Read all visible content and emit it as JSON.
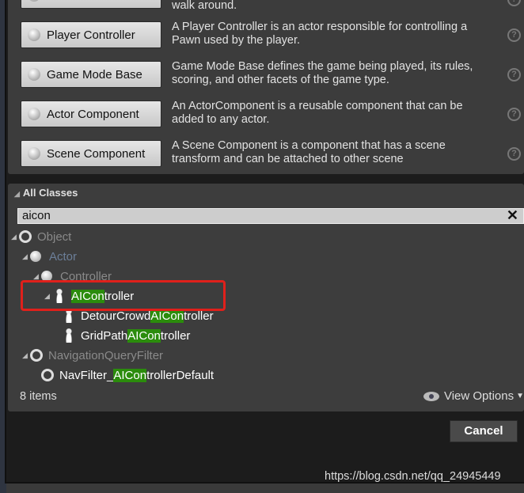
{
  "common_classes": [
    {
      "label": "",
      "desc": "walk around.",
      "icon": "pawn-icon"
    },
    {
      "label": "Player Controller",
      "desc": "A Player Controller is an actor responsible for controlling a Pawn used by the player.",
      "icon": "player-controller-icon"
    },
    {
      "label": "Game Mode Base",
      "desc": "Game Mode Base defines the game being played, its rules, scoring, and other facets of the game type.",
      "icon": "game-mode-icon"
    },
    {
      "label": "Actor Component",
      "desc": "An ActorComponent is a reusable component that can be added to any actor.",
      "icon": "actor-component-icon"
    },
    {
      "label": "Scene Component",
      "desc": "A Scene Component is a component that has a scene transform and can be attached to other scene",
      "icon": "scene-component-icon"
    }
  ],
  "help_glyph": "?",
  "all_classes": {
    "header": "All Classes",
    "search_value": "aicon",
    "clear_glyph": "✕",
    "highlight_color": "#2b8c0c",
    "tree": [
      {
        "pre": "Object",
        "match": "",
        "post": "",
        "color": "#8a8a8a",
        "icon": "ring",
        "expanded": true
      },
      {
        "pre": "Actor",
        "match": "",
        "post": "",
        "color": "#6c7f99",
        "icon": "ball",
        "expanded": true
      },
      {
        "pre": "Controller",
        "match": "",
        "post": "",
        "color": "#8a8a8a",
        "icon": "ball",
        "expanded": true
      },
      {
        "pre": "",
        "match": "AICon",
        "post": "troller",
        "color": "#ffffff",
        "icon": "pawn",
        "expanded": true
      },
      {
        "pre": "DetourCrowd",
        "match": "AICon",
        "post": "troller",
        "color": "#ffffff",
        "icon": "pawn",
        "expanded": false
      },
      {
        "pre": "GridPath",
        "match": "AICon",
        "post": "troller",
        "color": "#ffffff",
        "icon": "pawn",
        "expanded": false
      },
      {
        "pre": "NavigationQueryFilter",
        "match": "",
        "post": "",
        "color": "#8a8a8a",
        "icon": "ring",
        "expanded": true
      },
      {
        "pre": "NavFilter_",
        "match": "AICon",
        "post": "trollerDefault",
        "color": "#ffffff",
        "icon": "ring",
        "expanded": false
      }
    ],
    "item_count": "8 items",
    "view_options": "View Options"
  },
  "cancel_label": "Cancel",
  "watermark": "https://blog.csdn.net/qq_24945449"
}
